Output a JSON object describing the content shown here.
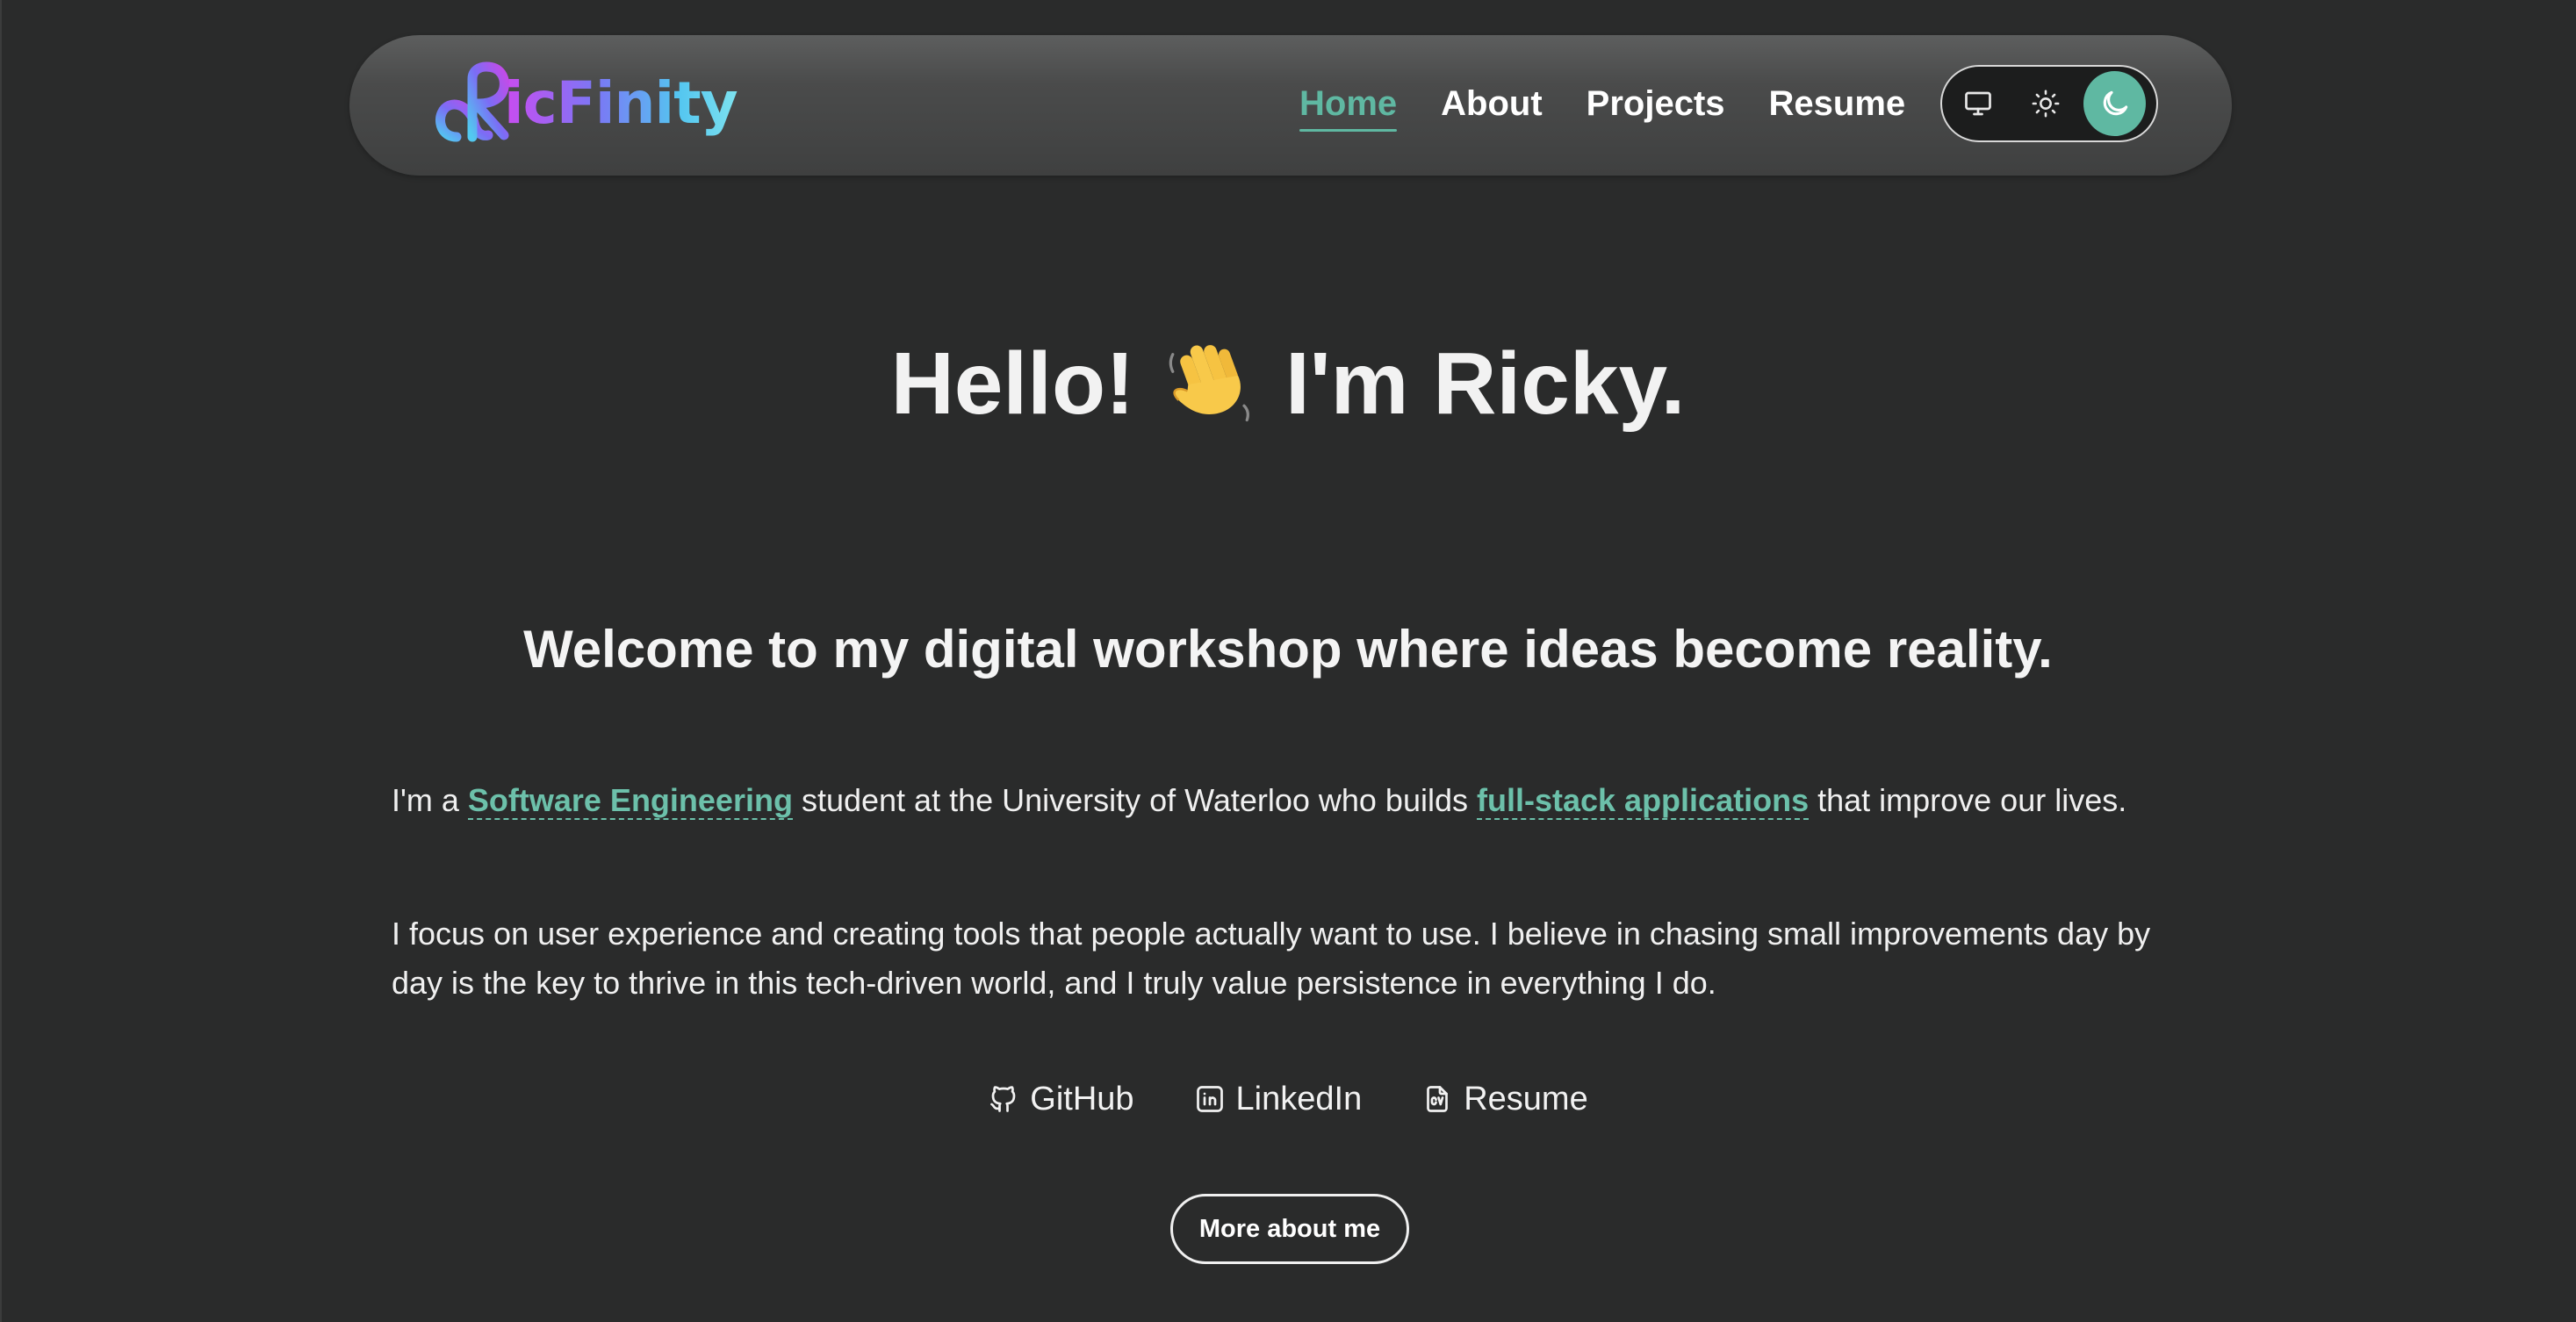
{
  "brand": {
    "logo_text": "icFinity",
    "logo_icon": "ricfinity-infinity-r-logo"
  },
  "nav": {
    "items": [
      {
        "label": "Home",
        "active": true
      },
      {
        "label": "About",
        "active": false
      },
      {
        "label": "Projects",
        "active": false
      },
      {
        "label": "Resume",
        "active": false
      }
    ]
  },
  "theme_switch": {
    "options": [
      {
        "icon": "monitor-icon",
        "mode": "system",
        "active": false
      },
      {
        "icon": "sun-icon",
        "mode": "light",
        "active": false
      },
      {
        "icon": "moon-icon",
        "mode": "dark",
        "active": true
      }
    ],
    "accent": "#5fb8a2"
  },
  "hero": {
    "greeting": "Hello!",
    "wave_icon": "waving-hand-icon",
    "name": "I'm Ricky."
  },
  "tagline": "Welcome to my digital workshop where ideas become reality.",
  "intro": {
    "p1_a": "I'm a ",
    "p1_link1": "Software Engineering",
    "p1_b": " student at the University of Waterloo who builds ",
    "p1_link2": "full-stack applications",
    "p1_c": " that improve our lives.",
    "p2": "I focus on user experience and creating tools that people actually want to use. I believe in chasing small improvements day by day is the key to thrive in this tech-driven world, and I truly value persistence in everything I do."
  },
  "social": [
    {
      "label": "GitHub",
      "icon": "github-icon"
    },
    {
      "label": "LinkedIn",
      "icon": "linkedin-icon"
    },
    {
      "label": "Resume",
      "icon": "cv-document-icon"
    }
  ],
  "cta": {
    "more_label": "More about me"
  },
  "colors": {
    "background": "#2a2b2b",
    "accent": "#5fb8a2",
    "text": "#f2f2f2"
  }
}
